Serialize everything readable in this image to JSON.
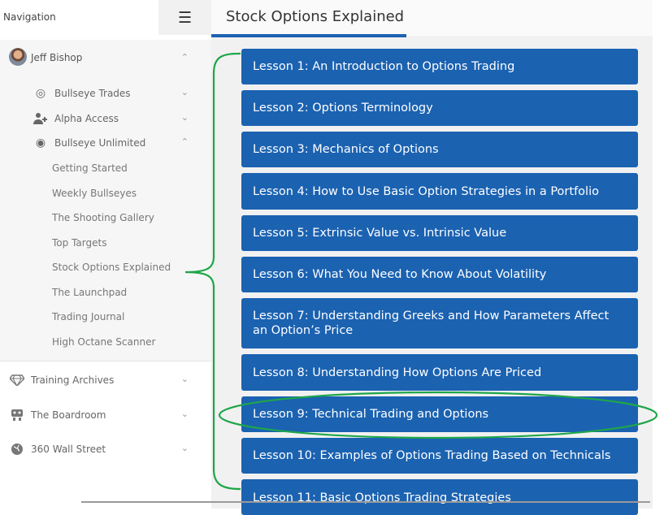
{
  "nav": {
    "title": "Navigation",
    "user": "Jeff Bishop",
    "items": [
      {
        "label": "Bullseye Trades",
        "icon": "target-icon"
      },
      {
        "label": "Alpha Access",
        "icon": "add-user-icon"
      },
      {
        "label": "Bullseye Unlimited",
        "icon": "bullseye-icon"
      }
    ],
    "sublinks": [
      "Getting Started",
      "Weekly Bullseyes",
      "The Shooting Gallery",
      "Top Targets",
      "Stock Options Explained",
      "The Launchpad",
      "Trading Journal",
      "High Octane Scanner"
    ],
    "sections": [
      {
        "label": "Training Archives",
        "icon": "diamond-icon"
      },
      {
        "label": "The Boardroom",
        "icon": "boardroom-icon"
      },
      {
        "label": "360 Wall Street",
        "icon": "globe-icon"
      }
    ]
  },
  "page": {
    "title": "Stock Options Explained",
    "lessons": [
      "Lesson 1: An Introduction to Options Trading",
      "Lesson 2: Options Terminology",
      "Lesson 3: Mechanics of Options",
      "Lesson 4: How to Use Basic Option Strategies in a Portfolio",
      "Lesson 5: Extrinsic Value vs. Intrinsic Value",
      "Lesson 6: What You Need to Know About Volatility",
      "Lesson 7: Understanding Greeks and How Parameters Affect an Option’s Price",
      "Lesson 8: Understanding How Options Are Priced",
      "Lesson 9: Technical Trading and Options",
      "Lesson 10: Examples of Options Trading Based on Technicals",
      "Lesson 11: Basic Options Trading Strategies"
    ]
  },
  "colors": {
    "accent": "#1b62b1",
    "annotation": "#1fa64a"
  }
}
